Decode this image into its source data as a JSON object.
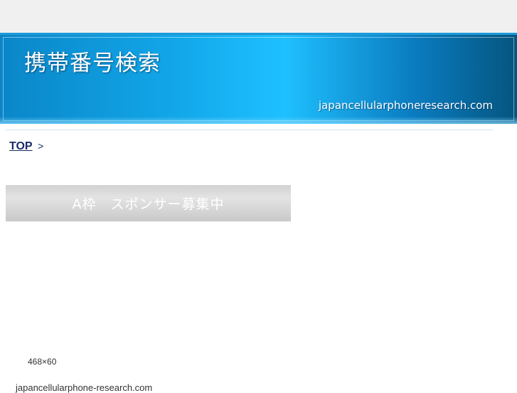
{
  "header": {
    "title": "携帯番号検索",
    "domain": "japancellularphoneresearch.com"
  },
  "breadcrumb": {
    "top_link": "TOP",
    "separator": ">"
  },
  "ad": {
    "label": "A枠　スポンサー募集中",
    "size_label": "468×60"
  },
  "footer": {
    "domain": "japancellularphone-research.com"
  }
}
